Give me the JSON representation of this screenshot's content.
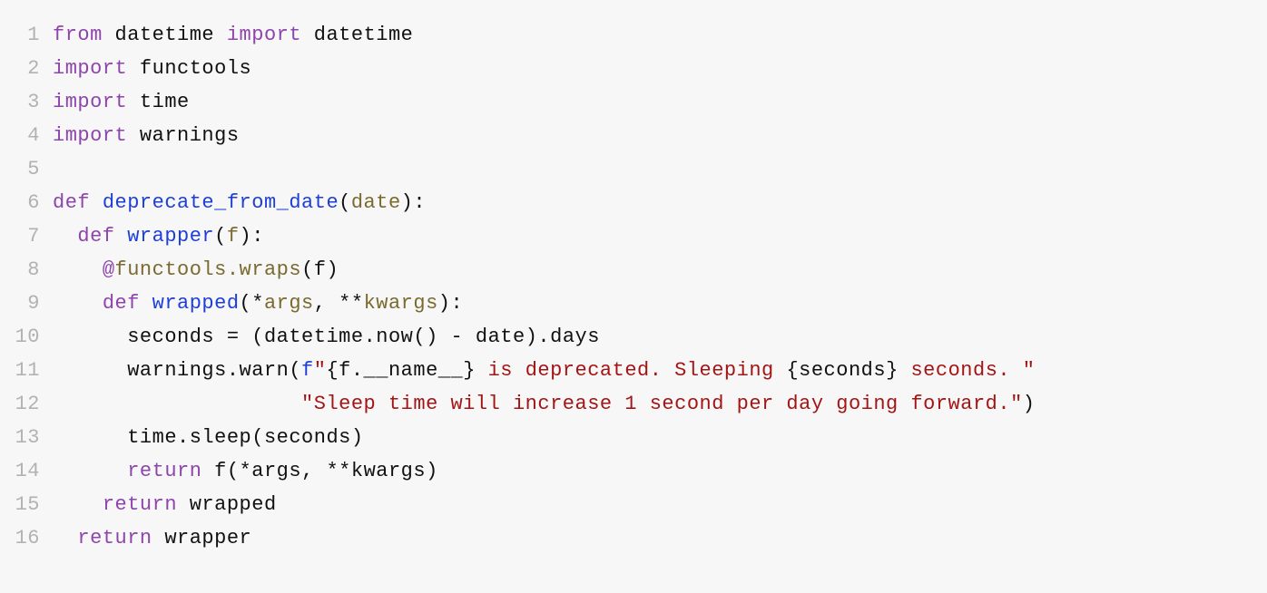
{
  "lines": [
    {
      "n": "1",
      "tokens": [
        {
          "cls": "kw",
          "t": "from"
        },
        {
          "cls": "id",
          "t": " datetime "
        },
        {
          "cls": "kw",
          "t": "import"
        },
        {
          "cls": "id",
          "t": " datetime"
        }
      ]
    },
    {
      "n": "2",
      "tokens": [
        {
          "cls": "kw",
          "t": "import"
        },
        {
          "cls": "id",
          "t": " functools"
        }
      ]
    },
    {
      "n": "3",
      "tokens": [
        {
          "cls": "kw",
          "t": "import"
        },
        {
          "cls": "id",
          "t": " time"
        }
      ]
    },
    {
      "n": "4",
      "tokens": [
        {
          "cls": "kw",
          "t": "import"
        },
        {
          "cls": "id",
          "t": " warnings"
        }
      ]
    },
    {
      "n": "5",
      "tokens": []
    },
    {
      "n": "6",
      "tokens": [
        {
          "cls": "kw",
          "t": "def"
        },
        {
          "cls": "id",
          "t": " "
        },
        {
          "cls": "def",
          "t": "deprecate_from_date"
        },
        {
          "cls": "punc",
          "t": "("
        },
        {
          "cls": "param",
          "t": "date"
        },
        {
          "cls": "punc",
          "t": ")"
        },
        {
          "cls": "punc",
          "t": ":"
        }
      ]
    },
    {
      "n": "7",
      "tokens": [
        {
          "cls": "id",
          "t": "  "
        },
        {
          "cls": "kw",
          "t": "def"
        },
        {
          "cls": "id",
          "t": " "
        },
        {
          "cls": "def",
          "t": "wrapper"
        },
        {
          "cls": "punc",
          "t": "("
        },
        {
          "cls": "param",
          "t": "f"
        },
        {
          "cls": "punc",
          "t": ")"
        },
        {
          "cls": "punc",
          "t": ":"
        }
      ]
    },
    {
      "n": "8",
      "tokens": [
        {
          "cls": "id",
          "t": "    "
        },
        {
          "cls": "at",
          "t": "@"
        },
        {
          "cls": "dec",
          "t": "functools.wraps"
        },
        {
          "cls": "punc",
          "t": "("
        },
        {
          "cls": "id",
          "t": "f"
        },
        {
          "cls": "punc",
          "t": ")"
        }
      ]
    },
    {
      "n": "9",
      "tokens": [
        {
          "cls": "id",
          "t": "    "
        },
        {
          "cls": "kw",
          "t": "def"
        },
        {
          "cls": "id",
          "t": " "
        },
        {
          "cls": "def",
          "t": "wrapped"
        },
        {
          "cls": "punc",
          "t": "("
        },
        {
          "cls": "punc",
          "t": "*"
        },
        {
          "cls": "param",
          "t": "args"
        },
        {
          "cls": "punc",
          "t": ", "
        },
        {
          "cls": "punc",
          "t": "**"
        },
        {
          "cls": "param",
          "t": "kwargs"
        },
        {
          "cls": "punc",
          "t": ")"
        },
        {
          "cls": "punc",
          "t": ":"
        }
      ]
    },
    {
      "n": "10",
      "tokens": [
        {
          "cls": "id",
          "t": "      seconds "
        },
        {
          "cls": "op",
          "t": "="
        },
        {
          "cls": "id",
          "t": " "
        },
        {
          "cls": "punc",
          "t": "("
        },
        {
          "cls": "id",
          "t": "datetime.now"
        },
        {
          "cls": "punc",
          "t": "()"
        },
        {
          "cls": "id",
          "t": " "
        },
        {
          "cls": "op",
          "t": "-"
        },
        {
          "cls": "id",
          "t": " date"
        },
        {
          "cls": "punc",
          "t": ")"
        },
        {
          "cls": "id",
          "t": ".days"
        }
      ]
    },
    {
      "n": "11",
      "tokens": [
        {
          "cls": "id",
          "t": "      warnings.warn"
        },
        {
          "cls": "punc",
          "t": "("
        },
        {
          "cls": "fpre",
          "t": "f"
        },
        {
          "cls": "str",
          "t": "\""
        },
        {
          "cls": "punc",
          "t": "{"
        },
        {
          "cls": "id",
          "t": "f.__name__"
        },
        {
          "cls": "punc",
          "t": "}"
        },
        {
          "cls": "str",
          "t": " is deprecated. Sleeping "
        },
        {
          "cls": "punc",
          "t": "{"
        },
        {
          "cls": "id",
          "t": "seconds"
        },
        {
          "cls": "punc",
          "t": "}"
        },
        {
          "cls": "str",
          "t": " seconds. \""
        }
      ]
    },
    {
      "n": "12",
      "tokens": [
        {
          "cls": "id",
          "t": "                    "
        },
        {
          "cls": "str",
          "t": "\"Sleep time will increase 1 second per day going forward.\""
        },
        {
          "cls": "punc",
          "t": ")"
        }
      ]
    },
    {
      "n": "13",
      "tokens": [
        {
          "cls": "id",
          "t": "      time.sleep"
        },
        {
          "cls": "punc",
          "t": "("
        },
        {
          "cls": "id",
          "t": "seconds"
        },
        {
          "cls": "punc",
          "t": ")"
        }
      ]
    },
    {
      "n": "14",
      "tokens": [
        {
          "cls": "id",
          "t": "      "
        },
        {
          "cls": "kw",
          "t": "return"
        },
        {
          "cls": "id",
          "t": " f"
        },
        {
          "cls": "punc",
          "t": "("
        },
        {
          "cls": "punc",
          "t": "*"
        },
        {
          "cls": "id",
          "t": "args"
        },
        {
          "cls": "punc",
          "t": ", "
        },
        {
          "cls": "punc",
          "t": "**"
        },
        {
          "cls": "id",
          "t": "kwargs"
        },
        {
          "cls": "punc",
          "t": ")"
        }
      ]
    },
    {
      "n": "15",
      "tokens": [
        {
          "cls": "id",
          "t": "    "
        },
        {
          "cls": "kw",
          "t": "return"
        },
        {
          "cls": "id",
          "t": " wrapped"
        }
      ]
    },
    {
      "n": "16",
      "tokens": [
        {
          "cls": "id",
          "t": "  "
        },
        {
          "cls": "kw",
          "t": "return"
        },
        {
          "cls": "id",
          "t": " wrapper"
        }
      ]
    }
  ]
}
